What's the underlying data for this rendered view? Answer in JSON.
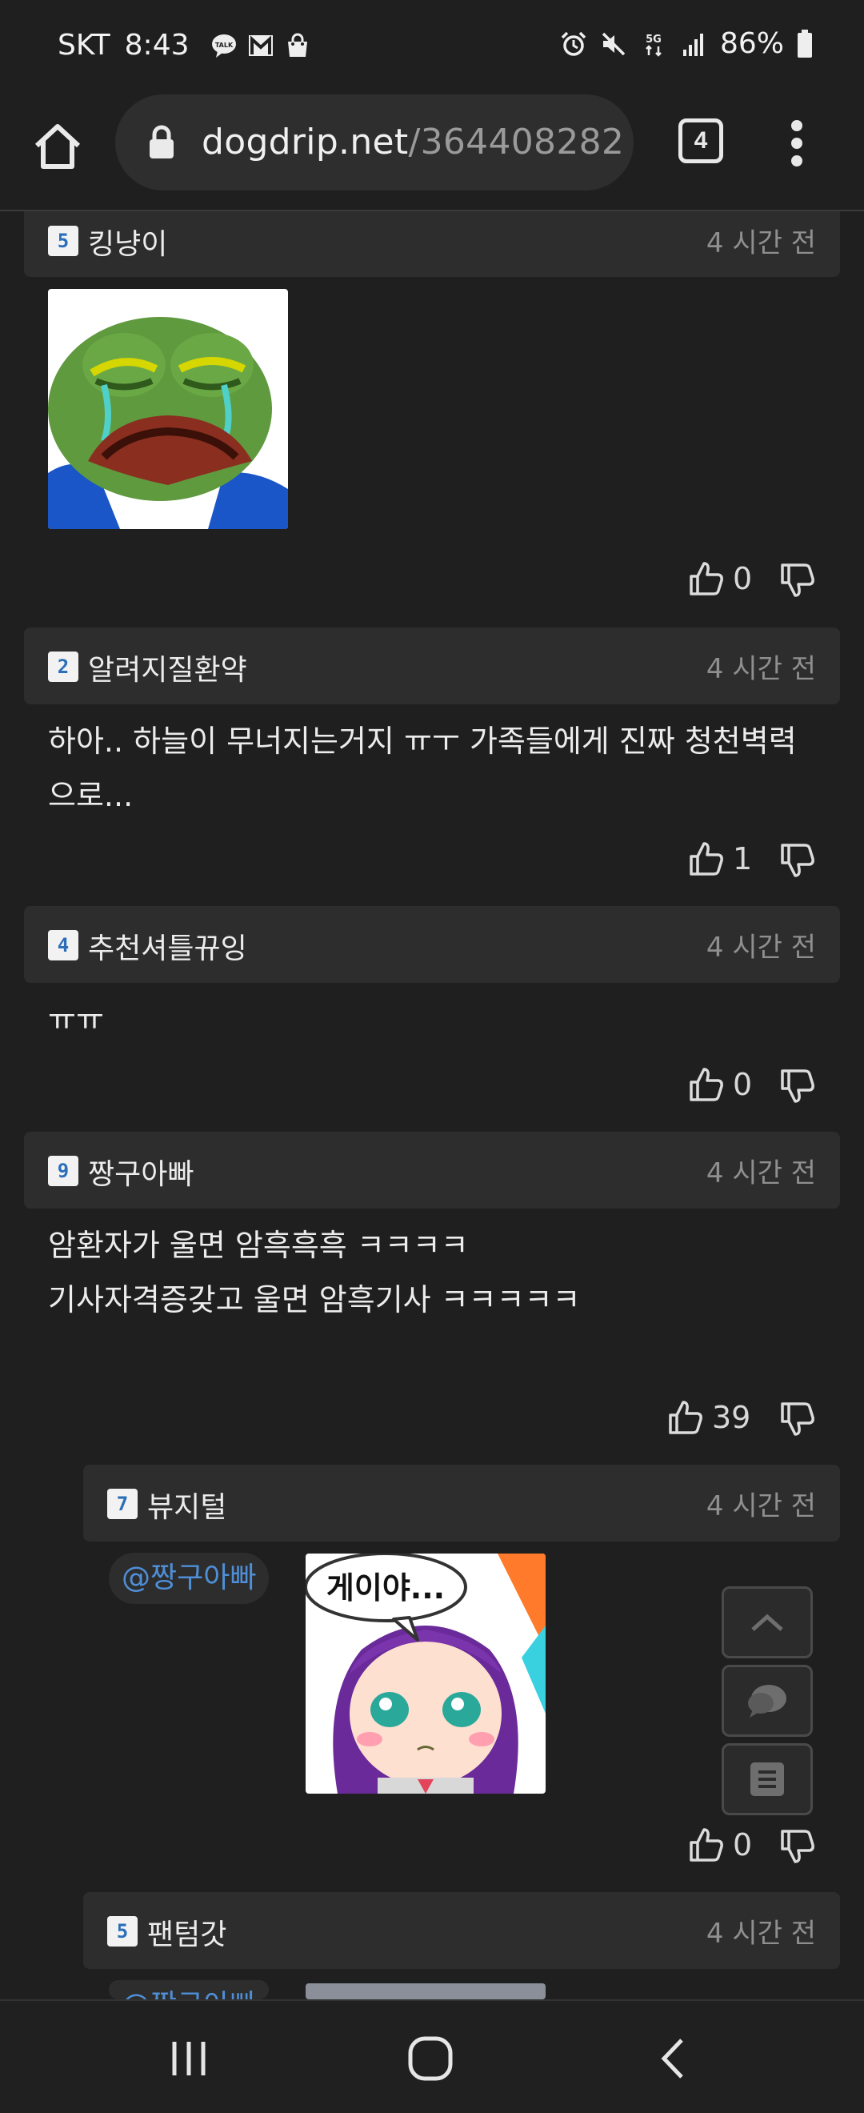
{
  "status_bar": {
    "carrier": "SKT",
    "time": "8:43",
    "battery": "86%",
    "left_icons": [
      "talk-icon",
      "gmail-icon",
      "shopping-bag-icon"
    ],
    "right_icons": [
      "alarm-icon",
      "mute-icon",
      "5g-icon",
      "signal-icon",
      "battery-icon"
    ]
  },
  "browser": {
    "url_host": "dogdrip.net",
    "url_path": "/364408282",
    "tab_count": "4"
  },
  "comments": [
    {
      "level": "5",
      "author": "킹냥이",
      "time": "4 시간 전",
      "text_lines": [],
      "image": "crying-frog-sticker",
      "likes": "0"
    },
    {
      "level": "2",
      "author": "알려지질환약",
      "time": "4 시간 전",
      "text_lines": [
        "하아.. 하늘이 무너지는거지 ㅠㅜ 가족들에게 진짜 청천벽력",
        "으로..."
      ],
      "likes": "1"
    },
    {
      "level": "4",
      "author": "추천셔틀뀨잉",
      "time": "4 시간 전",
      "text_lines": [
        "ㅠㅠ"
      ],
      "likes": "0"
    },
    {
      "level": "9",
      "author": "짱구아빠",
      "time": "4 시간 전",
      "text_lines": [
        "암환자가 울면 암흑흑흑 ㅋㅋㅋㅋ",
        "기사자격증갖고 울면 암흑기사 ㅋㅋㅋㅋㅋ"
      ],
      "likes": "39"
    },
    {
      "level": "7",
      "author": "뷰지털",
      "time": "4 시간 전",
      "mention": "@짱구아빠",
      "image": "anime-girl-sticker",
      "image_caption": "게이야...",
      "likes": "0"
    },
    {
      "level": "5",
      "author": "팬텀갓",
      "time": "4 시간 전",
      "mention": "@짱구아빠"
    }
  ],
  "floating_buttons": [
    "scroll-top-icon",
    "comment-icon",
    "list-icon"
  ],
  "bottom_nav": [
    "recent-apps-icon",
    "home-circle-icon",
    "back-icon"
  ],
  "colors": {
    "background": "#1f1f1f",
    "header_bg": "#2d2d2d",
    "mention": "#4e8fd8",
    "level_badge": "#2a6fb8"
  }
}
